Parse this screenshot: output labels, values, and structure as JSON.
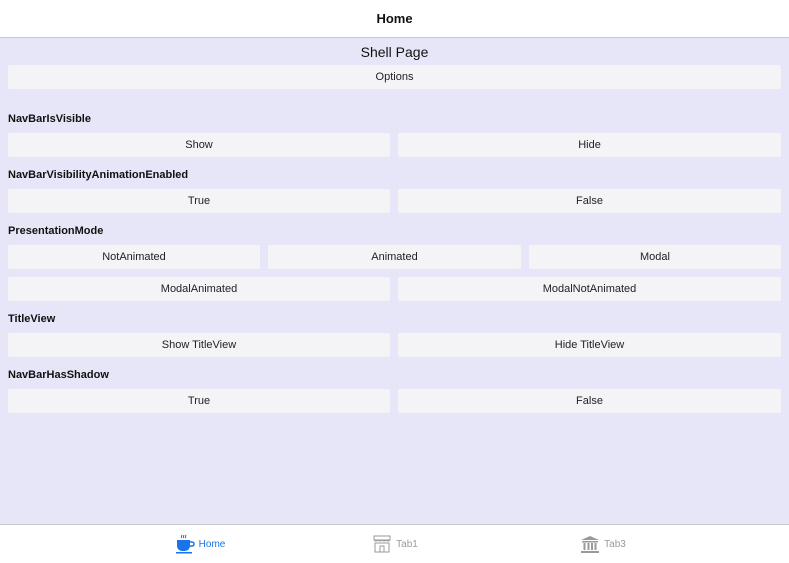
{
  "navbar": {
    "title": "Home"
  },
  "page": {
    "heading": "Shell Page",
    "options_label": "Options"
  },
  "sections": {
    "navbar_visible": {
      "label": "NavBarIsVisible",
      "show": "Show",
      "hide": "Hide"
    },
    "navbar_animation": {
      "label": "NavBarVisibilityAnimationEnabled",
      "true": "True",
      "false": "False"
    },
    "presentation_mode": {
      "label": "PresentationMode",
      "not_animated": "NotAnimated",
      "animated": "Animated",
      "modal": "Modal",
      "modal_animated": "ModalAnimated",
      "modal_not_animated": "ModalNotAnimated"
    },
    "title_view": {
      "label": "TitleView",
      "show": "Show TitleView",
      "hide": "Hide TitleView"
    },
    "navbar_shadow": {
      "label": "NavBarHasShadow",
      "true": "True",
      "false": "False"
    }
  },
  "tabbar": {
    "tabs": [
      {
        "label": "Home",
        "icon": "coffee-cup-icon",
        "active": true
      },
      {
        "label": "Tab1",
        "icon": "cafe-storefront-icon",
        "active": false
      },
      {
        "label": "Tab3",
        "icon": "bank-building-icon",
        "active": false
      }
    ]
  },
  "colors": {
    "content_bg": "#e6e6f8",
    "button_bg": "#f4f4f6",
    "active_tab": "#1a73e8",
    "inactive_tab": "#9a9a9e"
  }
}
